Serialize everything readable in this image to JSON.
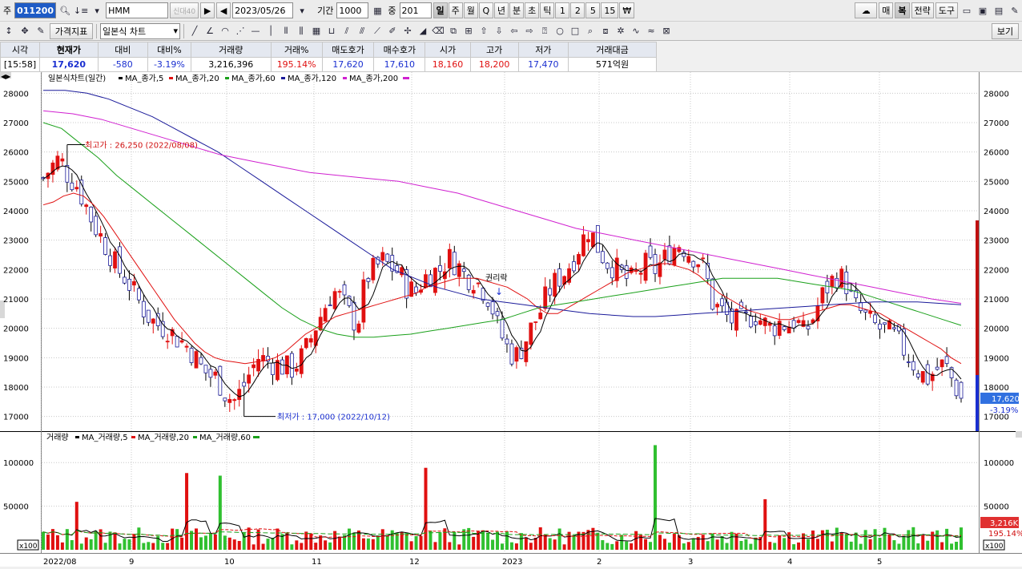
{
  "toolbar1": {
    "left_label": "주",
    "code": "011200",
    "name": "HMM",
    "name_badge": "신대40",
    "date": "2023/05/26",
    "period_label": "기간",
    "period_value": "1000",
    "count_label": "중",
    "count_value": "201",
    "timeframes": [
      "일",
      "주",
      "월",
      "Q",
      "년",
      "분",
      "초",
      "틱",
      "1",
      "2",
      "5",
      "15",
      "₩"
    ],
    "right_buttons": [
      "매",
      "복",
      "전략",
      "도구"
    ]
  },
  "toolbar2": {
    "indicator_button": "가격지표",
    "chart_type": "일본식 차트",
    "right_button": "보기"
  },
  "quote": {
    "headers": [
      "시각",
      "현재가",
      "대비",
      "대비%",
      "거래량",
      "거래%",
      "매도호가",
      "매수호가",
      "시가",
      "고가",
      "저가",
      "거래대금"
    ],
    "values": [
      "[15:58]",
      "17,620",
      "-580",
      "-3.19%",
      "3,216,396",
      "195.14%",
      "17,620",
      "17,610",
      "18,160",
      "18,200",
      "17,470",
      "571억원"
    ]
  },
  "price_chart": {
    "legend_title": "일본식차트(일간)",
    "legend_items": [
      {
        "label": "MA_종가,5",
        "color": "#000000"
      },
      {
        "label": "MA_종가,20",
        "color": "#e01010"
      },
      {
        "label": "MA_종가,60",
        "color": "#1aa01a"
      },
      {
        "label": "MA_종가,120",
        "color": "#1a1a9a"
      },
      {
        "label": "MA_종가,200",
        "color": "#d020d0"
      }
    ],
    "high_annotation": "최고가 : 26,250 (2022/08/08)",
    "low_annotation": "최저가 : 17,000 (2022/10/12)",
    "event_label": "권리락",
    "current_price_tag": "17,620",
    "current_pct_tag": "-3.19%"
  },
  "volume_chart": {
    "legend_title": "거래량",
    "legend_items": [
      {
        "label": "MA_거래량,5",
        "color": "#000000"
      },
      {
        "label": "MA_거래량,20",
        "color": "#e01010"
      },
      {
        "label": "MA_거래량,60",
        "color": "#1aa01a"
      }
    ],
    "unit_label": "x100",
    "current_volume_tag": "3,216K",
    "current_pct_tag": "195.14%"
  },
  "chart_data": [
    {
      "type": "candlestick",
      "title": "일본식차트(일간)",
      "ylim": [
        16500,
        28500
      ],
      "y_ticks": [
        17000,
        18000,
        19000,
        20000,
        21000,
        22000,
        23000,
        24000,
        25000,
        26000,
        27000,
        28000
      ],
      "x_ticks": [
        "2022/08",
        "9",
        "10",
        "11",
        "12",
        "2023",
        "2",
        "3",
        "4",
        "5"
      ],
      "grid": true,
      "key_points": [
        {
          "date": "2022/08/08",
          "price": 26250,
          "label": "최고가"
        },
        {
          "date": "2022/10/12",
          "price": 17000,
          "label": "최저가"
        }
      ],
      "close_path": [
        25100,
        25500,
        25800,
        25200,
        24900,
        24300,
        23600,
        23100,
        22600,
        22000,
        21700,
        21200,
        20700,
        20300,
        20100,
        20000,
        19700,
        19500,
        19200,
        18700,
        18400,
        18300,
        17800,
        17500,
        17900,
        18500,
        19000,
        18900,
        18800,
        18700,
        18600,
        18900,
        19400,
        20100,
        20700,
        21300,
        21000,
        20500,
        20100,
        21700,
        22000,
        22300,
        22100,
        21900,
        21400,
        21200,
        21700,
        21900,
        22000,
        22400,
        22200,
        21800,
        21700,
        21400,
        21000,
        20000,
        19400,
        19000,
        19400,
        20000,
        20500,
        21200,
        21600,
        21900,
        22300,
        22900,
        23400,
        22800,
        22300,
        22100,
        21800,
        21600,
        21900,
        22200,
        22000,
        22300,
        22700,
        22900,
        22600,
        22400,
        22000,
        20800,
        20600,
        20300,
        20200,
        20300,
        20500,
        20200,
        20000,
        20200,
        20100,
        20300,
        19800,
        20300,
        21000,
        21500,
        21800,
        21600,
        20800,
        20500,
        20200,
        20000,
        19900,
        19700,
        19300,
        18900,
        18500,
        18300,
        18600,
        18800,
        18200,
        17620
      ],
      "series": [
        {
          "name": "MA_종가,5",
          "color": "#000000"
        },
        {
          "name": "MA_종가,20",
          "color": "#e01010",
          "values": [
            24200,
            24300,
            24500,
            24600,
            24500,
            24200,
            23800,
            23300,
            22800,
            22300,
            21800,
            21300,
            20800,
            20300,
            19900,
            19500,
            19200,
            19000,
            18900,
            18850,
            18800,
            18850,
            18900,
            19000,
            19200,
            19500,
            19800,
            20000,
            20200,
            20400,
            20500,
            20600,
            20700,
            20800,
            20900,
            21000,
            21100,
            21200,
            21400,
            21500,
            21600,
            21700,
            21700,
            21700,
            21600,
            21500,
            21400,
            21200,
            21000,
            20700,
            20500,
            20500,
            20700,
            20900,
            21100,
            21300,
            21500,
            21700,
            21900,
            22000,
            22100,
            22200,
            22200,
            22100,
            22000,
            21800,
            21500,
            21200,
            21000,
            20800,
            20600,
            20500,
            20400,
            20300,
            20300,
            20400,
            20500,
            20600,
            20700,
            20800,
            20800,
            20700,
            20600,
            20500,
            20300,
            20100,
            19900,
            19700,
            19500,
            19300,
            19000,
            18800
          ]
        },
        {
          "name": "MA_종가,60",
          "color": "#1aa01a",
          "values": [
            27000,
            26800,
            26300,
            25800,
            25200,
            24700,
            24200,
            23700,
            23200,
            22700,
            22200,
            21700,
            21200,
            20700,
            20300,
            20000,
            19800,
            19700,
            19700,
            19750,
            19800,
            19900,
            20000,
            20100,
            20200,
            20300,
            20500,
            20700,
            20800,
            20900,
            21000,
            21100,
            21200,
            21300,
            21400,
            21500,
            21600,
            21700,
            21700,
            21700,
            21700,
            21600,
            21500,
            21400,
            21300,
            21100,
            20900,
            20700,
            20500,
            20300,
            20100
          ]
        },
        {
          "name": "MA_종가,120",
          "color": "#1a1a9a",
          "values": [
            28100,
            28100,
            28000,
            27800,
            27500,
            27200,
            26800,
            26400,
            26000,
            25500,
            25000,
            24500,
            24000,
            23500,
            23000,
            22500,
            22000,
            21700,
            21400,
            21200,
            21000,
            20900,
            20800,
            20700,
            20600,
            20500,
            20450,
            20400,
            20400,
            20450,
            20500,
            20550,
            20600,
            20650,
            20700,
            20750,
            20800,
            20850,
            20900,
            20900,
            20900,
            20850,
            20800
          ]
        },
        {
          "name": "MA_종가,200",
          "color": "#d020d0",
          "values": [
            27400,
            27300,
            27100,
            26800,
            26500,
            26200,
            25900,
            25700,
            25500,
            25300,
            25200,
            25100,
            25000,
            24800,
            24600,
            24300,
            24000,
            23700,
            23400,
            23200,
            23000,
            22800,
            22600,
            22400,
            22200,
            22000,
            21800,
            21600,
            21400,
            21200,
            21000,
            20850
          ]
        }
      ]
    },
    {
      "type": "bar",
      "title": "거래량",
      "ylim": [
        0,
        125000
      ],
      "y_ticks": [
        50000,
        100000
      ],
      "unit": "x100",
      "spike_values": [
        {
          "x_index": 7,
          "value": 55000
        },
        {
          "x_index": 30,
          "value": 88000
        },
        {
          "x_index": 37,
          "value": 85000
        },
        {
          "x_index": 80,
          "value": 94000
        },
        {
          "x_index": 128,
          "value": 120000
        },
        {
          "x_index": 151,
          "value": 58000
        }
      ],
      "series": [
        {
          "name": "MA_거래량,5",
          "color": "#000000"
        },
        {
          "name": "MA_거래량,20",
          "color": "#e01010"
        },
        {
          "name": "MA_거래량,60",
          "color": "#1aa01a"
        }
      ]
    }
  ]
}
